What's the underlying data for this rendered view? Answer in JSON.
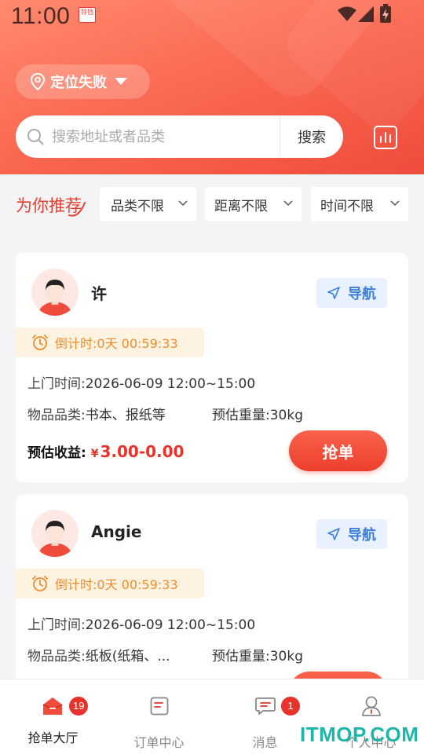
{
  "status_bar": {
    "time": "11:00",
    "app_badge": "铃铛"
  },
  "location": {
    "label": "定位失败"
  },
  "search": {
    "placeholder": "搜索地址或者品类",
    "button": "搜索"
  },
  "recommend": {
    "title": "为你推荐"
  },
  "filters": [
    {
      "label": "品类不限"
    },
    {
      "label": "距离不限"
    },
    {
      "label": "时间不限"
    }
  ],
  "orders": [
    {
      "name": "许",
      "nav_label": "导航",
      "countdown_label": "倒计时:",
      "countdown_value": "0天 00:59:33",
      "visit_time_label": "上门时间:",
      "visit_time": "2026-06-09 12:00~15:00",
      "category_label": "物品品类:",
      "category": "书本、报纸等",
      "weight_label": "预估重量:",
      "weight": "30kg",
      "earning_label": "预估收益:",
      "currency": "¥",
      "earning": "3.00-0.00",
      "grab_label": "抢单"
    },
    {
      "name": "Angie",
      "nav_label": "导航",
      "countdown_label": "倒计时:",
      "countdown_value": "0天 00:59:33",
      "visit_time_label": "上门时间:",
      "visit_time": "2026-06-09 12:00~15:00",
      "category_label": "物品品类:",
      "category": "纸板(纸箱、...",
      "weight_label": "预估重量:",
      "weight": "30kg"
    }
  ],
  "tabbar": [
    {
      "label": "抢单大厅",
      "badge": "19",
      "active": true
    },
    {
      "label": "订单中心"
    },
    {
      "label": "消息",
      "badge": "1"
    },
    {
      "label": "个人中心"
    }
  ],
  "watermark": "ITMOP.COM",
  "colors": {
    "accent": "#ef4c3c",
    "nav_blue": "#3d7fe0",
    "countdown": "#f08b2c"
  }
}
